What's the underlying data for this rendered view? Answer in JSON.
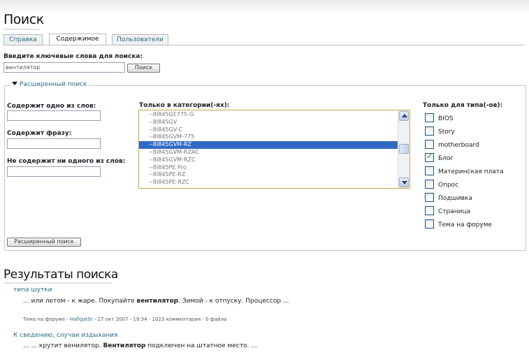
{
  "page": {
    "title": "Поиск"
  },
  "tabs": [
    {
      "label": "Справка",
      "active": false
    },
    {
      "label": "Содержимое",
      "active": true
    },
    {
      "label": "Пользователи",
      "active": false
    }
  ],
  "search": {
    "label": "Введите ключевые слова для поиска:",
    "value": "вентилятор",
    "button": "Поиск"
  },
  "advanced": {
    "legend": "Расширенный поиск",
    "any_label": "Содержит одно из слов:",
    "phrase_label": "Содержит фразу:",
    "none_label": "Не содержит ни одного из слов:",
    "category_label": "Только в категории(-ях):",
    "categories": [
      "--8I845GE775-G",
      "--8I845GV",
      "--8I845GV-C",
      "--8I845GVM-775",
      "--8I845GVM-RZ",
      "--8I845GVM-RZAC",
      "--8I845GVM-RZC",
      "--8I845PE Pro",
      "--8I845PE-RZ",
      "--8I845PE-RZC"
    ],
    "selected_category": "--8I845GVM-RZ",
    "type_label": "Только для типа(-ов):",
    "types": [
      {
        "label": "BIOS",
        "checked": false
      },
      {
        "label": "Story",
        "checked": false
      },
      {
        "label": "motherboard",
        "checked": false
      },
      {
        "label": "Блог",
        "checked": true
      },
      {
        "label": "Материнская плата",
        "checked": false
      },
      {
        "label": "Опрос",
        "checked": false
      },
      {
        "label": "Подшивка",
        "checked": false
      },
      {
        "label": "Страница",
        "checked": false
      },
      {
        "label": "Тема на форуме",
        "checked": false
      }
    ],
    "button": "Расширенный поиск"
  },
  "results": {
    "title": "Результаты поиска",
    "items": [
      {
        "title": "типа шутки",
        "snippet_before": "... или летом - к жаре. Покупайте ",
        "snippet_bold": "вентилятор",
        "snippet_after": ". Зимой - к отпуску. Процессор ...",
        "meta_prefix": "Тема на форуме - ",
        "meta_user": "Hafigat0r",
        "meta_suffix": " - 27 окт 2007 - 19:34 - 1023 комментария - 0 файла"
      },
      {
        "title": "К сведению, случаи издыхания",
        "snippet_before": "... ... крутит венилятор. ",
        "snippet_bold": "Вентилятор",
        "snippet_after": " подключен на штатное место. ..."
      }
    ]
  }
}
